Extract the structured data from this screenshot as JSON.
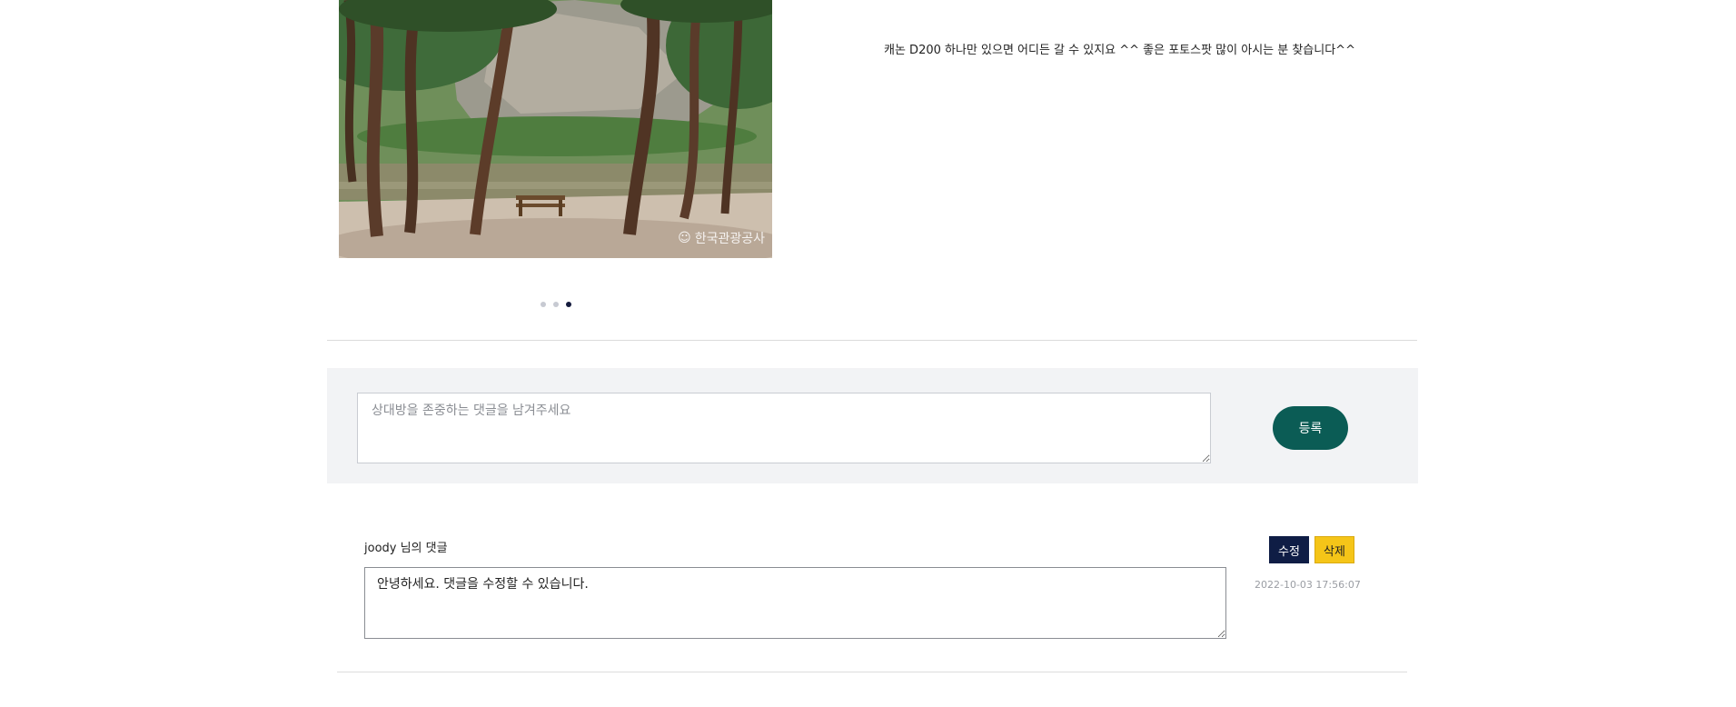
{
  "post": {
    "description": "캐논 D200 하나만 있으면 어디든 갈 수 있지요 ^^ 좋은 포토스팟 많이 아시는 분 찾습니다^^",
    "photo_watermark": "한국관광공사",
    "carousel": {
      "count": 3,
      "active_index": 2
    }
  },
  "comment_form": {
    "placeholder": "상대방을 존중하는 댓글을 남겨주세요",
    "value": "",
    "submit_label": "등록"
  },
  "comments": [
    {
      "author_label": "joody 님의 댓글",
      "content": "안녕하세요. 댓글을 수정할 수 있습니다.",
      "edit_label": "수정",
      "delete_label": "삭제",
      "timestamp": "2022-10-03 17:56:07"
    }
  ],
  "colors": {
    "submit_button": "#0b5c55",
    "edit_button": "#0f1d45",
    "delete_button": "#f5c518",
    "comment_box_bg": "#f2f3f5",
    "active_dot": "#141b3d"
  }
}
